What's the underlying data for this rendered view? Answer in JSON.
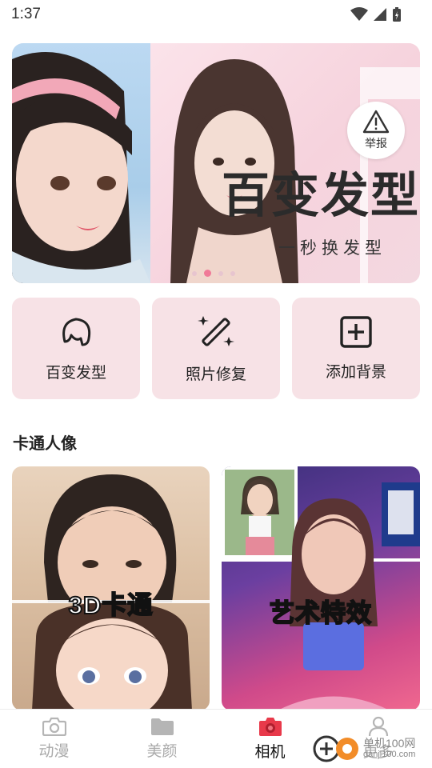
{
  "status_bar": {
    "time": "1:37"
  },
  "banner": {
    "title": "百变发型",
    "subtitle": "一秒换发型",
    "report_label": "举报",
    "page_count": 4,
    "active_index": 1
  },
  "actions": [
    {
      "label": "百变发型",
      "icon": "hair-icon"
    },
    {
      "label": "照片修复",
      "icon": "magic-wand-icon"
    },
    {
      "label": "添加背景",
      "icon": "add-box-icon"
    }
  ],
  "section": {
    "title": "卡通人像"
  },
  "cards": [
    {
      "label": "3D卡通"
    },
    {
      "label": "艺术特效"
    }
  ],
  "bottom_nav": [
    {
      "label": "动漫",
      "icon": "camera-icon",
      "active": false
    },
    {
      "label": "美颜",
      "icon": "folder-icon",
      "active": false
    },
    {
      "label": "相机",
      "icon": "camera-app-icon",
      "active": true
    },
    {
      "label": "更多",
      "icon": "user-icon",
      "active": false
    }
  ],
  "watermark": {
    "text": "单机100网",
    "url": "danji100.com"
  },
  "colors": {
    "accent": "#f07a98",
    "card_bg": "#f7e2e6",
    "nav_active": "#e8394a"
  }
}
